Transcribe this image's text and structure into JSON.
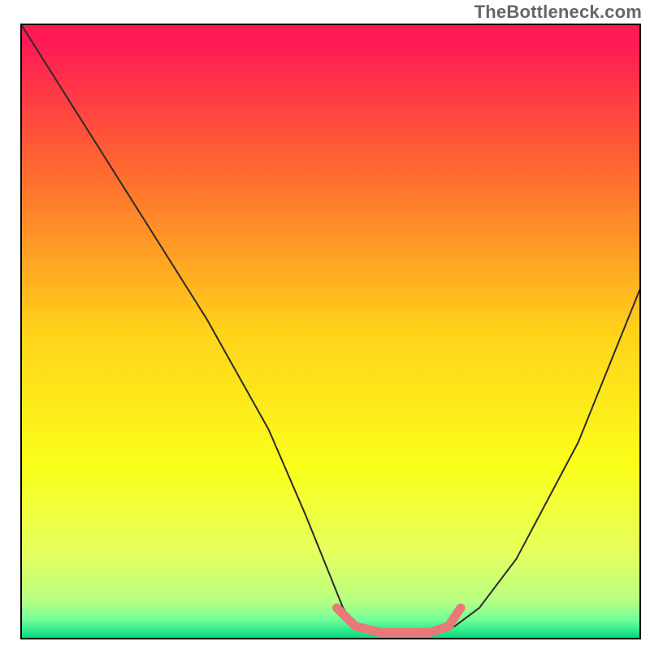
{
  "watermark": {
    "text": "TheBottleneck.com"
  },
  "chart_data": {
    "type": "line",
    "title": "",
    "xlabel": "",
    "ylabel": "",
    "xlim": [
      0,
      100
    ],
    "ylim": [
      0,
      100
    ],
    "background_gradient_stops": [
      {
        "offset": 0.0,
        "color": "#ff1a54"
      },
      {
        "offset": 0.03,
        "color": "#ff1a54"
      },
      {
        "offset": 0.25,
        "color": "#ff6e2e"
      },
      {
        "offset": 0.5,
        "color": "#ffd21a"
      },
      {
        "offset": 0.72,
        "color": "#faff1a"
      },
      {
        "offset": 0.86,
        "color": "#e5ff5e"
      },
      {
        "offset": 0.94,
        "color": "#b6ff84"
      },
      {
        "offset": 0.97,
        "color": "#6dff99"
      },
      {
        "offset": 1.0,
        "color": "#00d97f"
      }
    ],
    "series": [
      {
        "name": "bottleneck-curve",
        "color": "#2b2b2b",
        "stroke_width": 2.0,
        "x": [
          0.0,
          10,
          20,
          30,
          40,
          46,
          50,
          52,
          54,
          58,
          62,
          66,
          70,
          74,
          80,
          90,
          100
        ],
        "y": [
          100,
          84,
          68,
          52,
          34,
          20,
          10,
          5,
          2,
          1,
          1,
          1,
          2,
          5,
          13,
          32,
          57
        ]
      },
      {
        "name": "optimal-range-marker",
        "color": "#e97878",
        "stroke_width": 11,
        "linecap": "round",
        "x": [
          51,
          54,
          58,
          62,
          66,
          69,
          71
        ],
        "y": [
          5,
          2,
          1,
          1,
          1,
          2,
          5
        ]
      }
    ],
    "frame": {
      "color": "#000000",
      "width": 2
    }
  }
}
